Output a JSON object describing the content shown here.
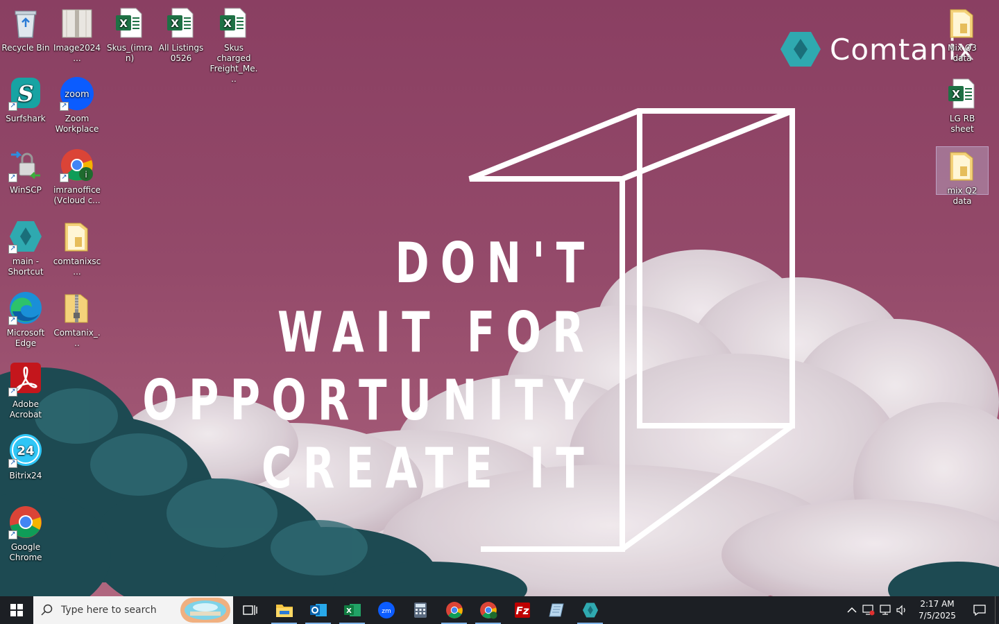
{
  "wallpaper": {
    "brand_name": "Comtanix",
    "quote_lines": [
      "DON'T",
      "WAIT FOR",
      "OPPORTUNITY",
      "CREATE IT"
    ]
  },
  "desktop_icons_left": [
    {
      "label": "Recycle Bin",
      "icon": "recycle-bin-icon"
    },
    {
      "label": "Image2024...",
      "icon": "archive-file-icon"
    },
    {
      "label": "Skus_(imran)",
      "icon": "excel-file-icon"
    },
    {
      "label": "All Listings 0526",
      "icon": "excel-file-icon"
    },
    {
      "label": "Skus charged Freight_Me...",
      "icon": "excel-file-icon"
    },
    {
      "label": "Surfshark",
      "icon": "surfshark-icon"
    },
    {
      "label": "Zoom Workplace",
      "icon": "zoom-icon"
    },
    {
      "label": "WinSCP",
      "icon": "winscp-icon"
    },
    {
      "label": "imranoffice (Vcloud c...",
      "icon": "chrome-profile-icon"
    },
    {
      "label": "main - Shortcut",
      "icon": "comtanix-app-icon"
    },
    {
      "label": "comtanixsc...",
      "icon": "folder-icon"
    },
    {
      "label": "Microsoft Edge",
      "icon": "edge-icon"
    },
    {
      "label": "Comtanix_...",
      "icon": "zip-folder-icon"
    },
    {
      "label": "Adobe Acrobat",
      "icon": "acrobat-icon"
    },
    {
      "label": "Bitrix24",
      "icon": "bitrix24-icon"
    },
    {
      "label": "Google Chrome",
      "icon": "chrome-icon"
    }
  ],
  "desktop_icons_right": [
    {
      "label": "Mix Q3 data",
      "icon": "folder-icon"
    },
    {
      "label": "LG RB sheet",
      "icon": "excel-file-icon"
    },
    {
      "label": "mix Q2 data",
      "icon": "folder-icon",
      "selected": true
    }
  ],
  "taskbar": {
    "search_placeholder": "Type here to search",
    "pinned_apps": [
      {
        "name": "task-view",
        "icon": "task-view-icon",
        "running": false
      },
      {
        "name": "file-explorer",
        "icon": "file-explorer-icon",
        "running": true
      },
      {
        "name": "outlook",
        "icon": "outlook-icon",
        "running": true
      },
      {
        "name": "excel",
        "icon": "excel-icon",
        "running": true
      },
      {
        "name": "zoom",
        "icon": "zoom-icon",
        "running": false
      },
      {
        "name": "calculator",
        "icon": "calculator-icon",
        "running": false
      },
      {
        "name": "chrome",
        "icon": "chrome-icon",
        "running": true
      },
      {
        "name": "chrome-profile",
        "icon": "chrome-profile-icon",
        "running": true
      },
      {
        "name": "filezilla",
        "icon": "filezilla-icon",
        "running": false
      },
      {
        "name": "notes",
        "icon": "notes-icon",
        "running": false
      },
      {
        "name": "comtanix",
        "icon": "comtanix-app-icon",
        "running": true
      }
    ],
    "tray": {
      "time": "2:17 AM",
      "date": "7/5/2025"
    }
  },
  "colors": {
    "wallpaper_top": "#8a3f62",
    "wallpaper_bottom": "#b0677f",
    "taskbar": "#1c1f24",
    "brand_teal": "#2fa9b0"
  }
}
